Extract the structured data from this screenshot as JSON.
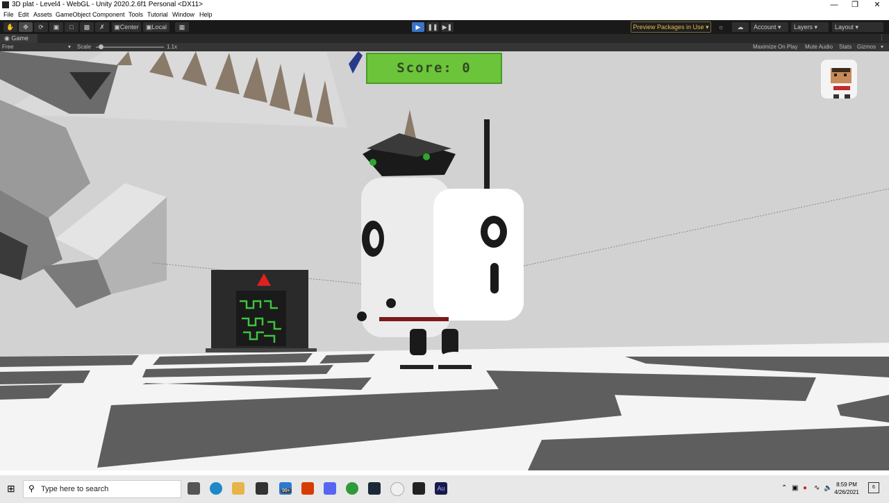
{
  "window": {
    "title": "3D plat - Level4 - WebGL - Unity 2020.2.6f1 Personal <DX11>"
  },
  "menu": [
    "File",
    "Edit",
    "Assets",
    "GameObject",
    "Component",
    "Tools",
    "Tutorial",
    "Window",
    "Help"
  ],
  "toolbar": {
    "pivot": "Center",
    "space": "Local",
    "preview_packages": "Preview Packages in Use",
    "account": "Account",
    "layers": "Layers",
    "layout": "Layout"
  },
  "game_view": {
    "tab_label": "Game",
    "aspect": "Free Aspect",
    "scale_label": "Scale",
    "scale_value": "1.1x",
    "maximize_on_play": "Maximize On Play",
    "mute_audio": "Mute Audio",
    "stats": "Stats",
    "gizmos": "Gizmos"
  },
  "hud": {
    "score_text": "Score: 0"
  },
  "taskbar": {
    "search_placeholder": "Type here to search",
    "badge": "99+",
    "time": "8:59 PM",
    "date": "4/26/2021",
    "notification_count": "6"
  },
  "colors": {
    "score_bg": "#6cc43a",
    "play_accent": "#3a72c8",
    "preview_packages": "#e8b74a"
  }
}
